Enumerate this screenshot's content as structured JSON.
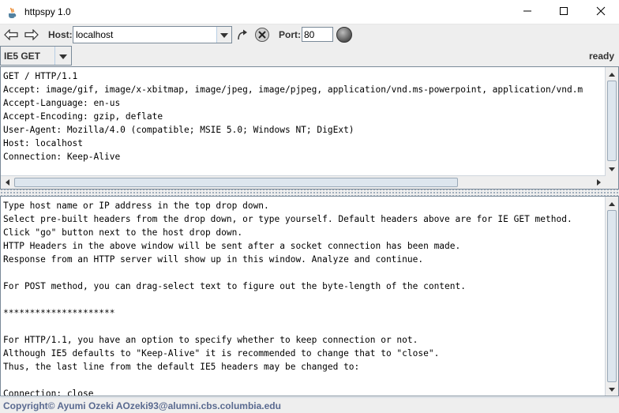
{
  "window": {
    "title": "httpspy 1.0",
    "icons": {
      "app": "java-cup-icon",
      "minimize": "minimize-icon",
      "maximize": "maximize-icon",
      "close": "close-icon"
    }
  },
  "toolbar": {
    "back_icon": "arrow-left-icon",
    "forward_icon": "arrow-right-icon",
    "host_label": "Host:",
    "host_value": "localhost",
    "go_icon": "go-arrow-icon",
    "stop_icon": "stop-x-icon",
    "port_label": "Port:",
    "port_value": "80",
    "status_light_icon": "status-light-icon"
  },
  "controls": {
    "method_value": "IE5 GET",
    "status": "ready"
  },
  "request_pane": {
    "lines": [
      "GET / HTTP/1.1",
      "Accept: image/gif, image/x-xbitmap, image/jpeg, image/pjpeg, application/vnd.ms-powerpoint, application/vnd.m",
      "Accept-Language: en-us",
      "Accept-Encoding: gzip, deflate",
      "User-Agent: Mozilla/4.0 (compatible; MSIE 5.0; Windows NT; DigExt)",
      "Host: localhost",
      "Connection: Keep-Alive"
    ]
  },
  "response_pane": {
    "lines": [
      "Type host name or IP address in the top drop down.",
      "Select pre-built headers from the drop down, or type yourself. Default headers above are for IE GET method.",
      "Click \"go\" button next to the host drop down.",
      "HTTP Headers in the above window will be sent after a socket connection has been made.",
      "Response from an HTTP server will show up in this window. Analyze and continue.",
      "",
      "For POST method, you can drag-select text to figure out the byte-length of the content.",
      "",
      "*********************",
      "",
      "For HTTP/1.1, you have an option to specify whether to keep connection or not.",
      "Although IE5 defaults to \"Keep-Alive\" it is recommended to change that to \"close\".",
      "Thus, the last line from the default IE5 headers may be changed to:",
      "",
      "Connection: close"
    ]
  },
  "footer": {
    "text": "Copyright© Ayumi Ozeki  AOzeki93@alumni.cbs.columbia.edu"
  },
  "colors": {
    "panel_bg": "#eeeeee",
    "border": "#7a8a99",
    "footer_text": "#5a6a90"
  }
}
